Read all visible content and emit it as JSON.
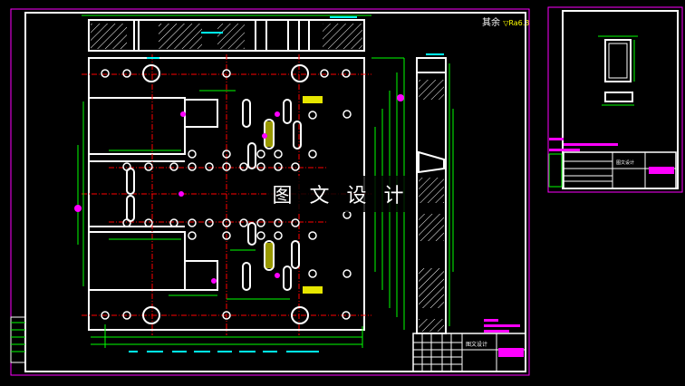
{
  "drawing": {
    "surface_note": "其余",
    "surface_symbol": "▽Ra6.3",
    "watermark": "图 文 设 计",
    "title_block_main": {
      "company": "图文设计",
      "drawing_no": ""
    },
    "title_block_detail": {
      "company": "图文设计",
      "drawing_no": ""
    }
  },
  "colors": {
    "background": "#000000",
    "outline": "#ffffff",
    "dimension": "#00ff00",
    "centerline": "#ff0000",
    "hatch": "#ffffff",
    "annotation": "#ff00ff",
    "text_cyan": "#00ffff",
    "text_yellow": "#ffff00",
    "border_magenta": "#ff00ff"
  }
}
